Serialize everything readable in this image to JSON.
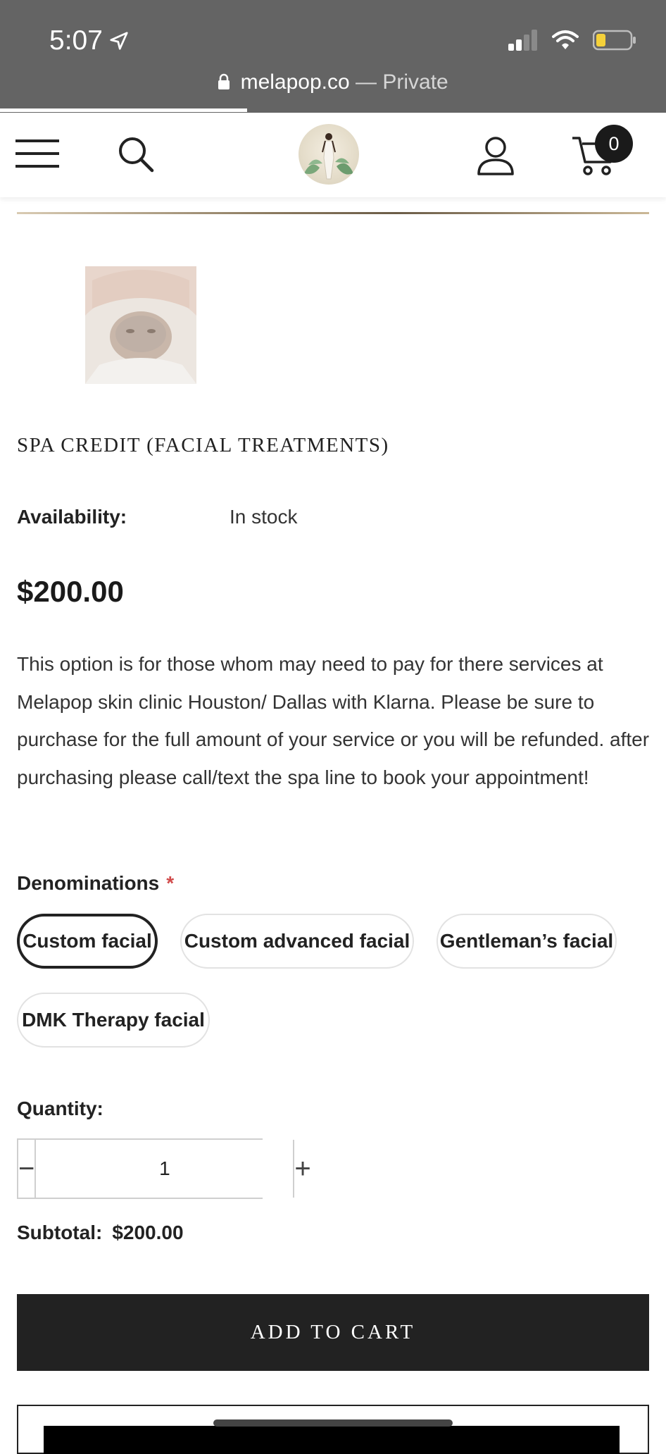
{
  "status_bar": {
    "time": "5:07"
  },
  "browser": {
    "domain": "melapop.co",
    "mode_label": "— Private"
  },
  "header": {
    "cart_count": "0"
  },
  "product": {
    "title": "SPA CREDIT (FACIAL TREATMENTS)",
    "availability_label": "Availability:",
    "availability_value": "In stock",
    "price": "$200.00",
    "description": "This option is for those whom may need to pay for there services at Melapop skin clinic Houston/ Dallas with Klarna.   Please be sure to purchase for the full amount of your service or you will be refunded. after purchasing please call/text the spa line to book your appointment!"
  },
  "denominations": {
    "label": "Denominations",
    "required_mark": "*",
    "options": [
      "Custom facial",
      "Custom advanced facial",
      "Gentleman’s facial",
      "DMK Therapy facial"
    ],
    "selected": "Custom facial"
  },
  "quantity": {
    "label": "Quantity:",
    "value": "1",
    "minus": "−",
    "plus": "+"
  },
  "subtotal": {
    "label": "Subtotal:",
    "value": "$200.00"
  },
  "add_to_cart_label": "ADD TO CART",
  "colors": {
    "chrome": "#646464",
    "button": "#222222",
    "required": "#d14b4b"
  }
}
